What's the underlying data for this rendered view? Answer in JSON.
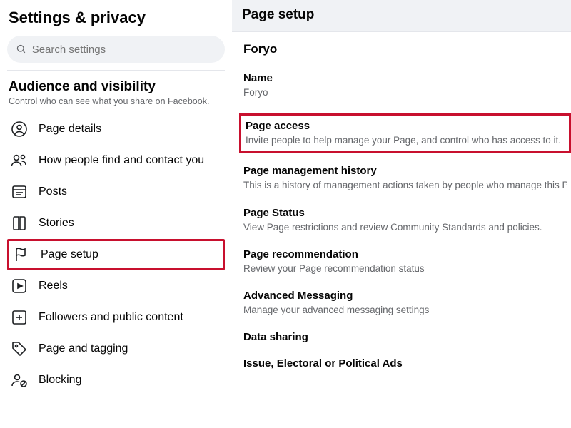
{
  "sidebar": {
    "title": "Settings & privacy",
    "search_placeholder": "Search settings",
    "section_heading": "Audience and visibility",
    "section_sub": "Control who can see what you share on Facebook.",
    "items": [
      {
        "label": "Page details"
      },
      {
        "label": "How people find and contact you"
      },
      {
        "label": "Posts"
      },
      {
        "label": "Stories"
      },
      {
        "label": "Page setup"
      },
      {
        "label": "Reels"
      },
      {
        "label": "Followers and public content"
      },
      {
        "label": "Page and tagging"
      },
      {
        "label": "Blocking"
      }
    ]
  },
  "main": {
    "header": "Page setup",
    "page_name": "Foryo",
    "settings": [
      {
        "title": "Name",
        "desc": "Foryo"
      },
      {
        "title": "Page access",
        "desc": "Invite people to help manage your Page, and control who has access to it."
      },
      {
        "title": "Page management history",
        "desc": "This is a history of management actions taken by people who manage this Page."
      },
      {
        "title": "Page Status",
        "desc": "View Page restrictions and review Community Standards and policies."
      },
      {
        "title": "Page recommendation",
        "desc": "Review your Page recommendation status"
      },
      {
        "title": "Advanced Messaging",
        "desc": "Manage your advanced messaging settings"
      },
      {
        "title": "Data sharing",
        "desc": ""
      },
      {
        "title": "Issue, Electoral or Political Ads",
        "desc": ""
      }
    ]
  }
}
